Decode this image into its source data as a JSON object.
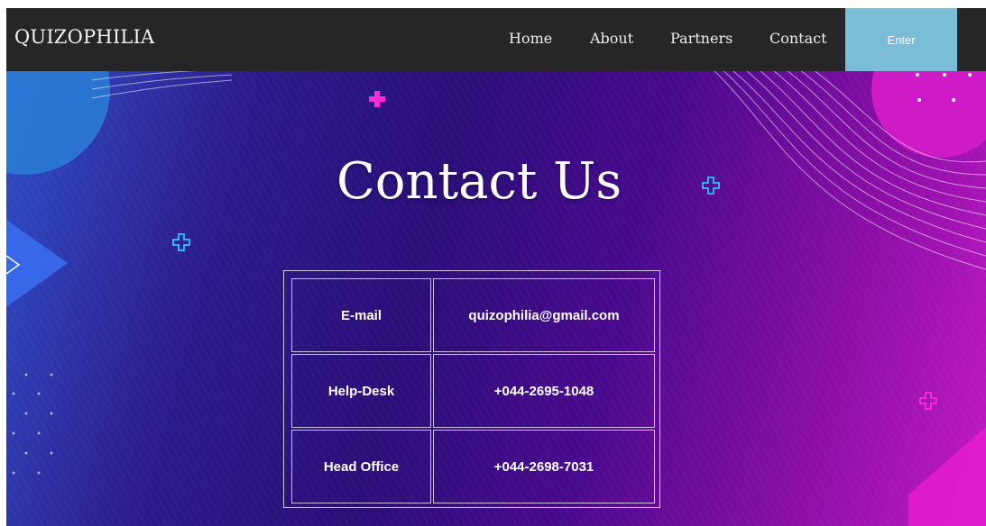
{
  "header": {
    "brand": "QUIZOPHILIA",
    "nav": [
      {
        "label": "Home"
      },
      {
        "label": "About"
      },
      {
        "label": "Partners"
      },
      {
        "label": "Contact"
      }
    ],
    "enter_label": "Enter"
  },
  "main": {
    "title": "Contact Us",
    "contacts": [
      {
        "label": "E-mail",
        "value": "quizophilia@gmail.com"
      },
      {
        "label": "Help-Desk",
        "value": "+044-2695-1048"
      },
      {
        "label": "Head Office",
        "value": "+044-2698-7031"
      }
    ]
  },
  "colors": {
    "navbar": "#262626",
    "enter_button": "#7bbcd6",
    "accent_pink": "#ff2bd6",
    "accent_cyan": "#2fc3ff"
  },
  "icons": [
    "plus-icon",
    "plus-outline-icon",
    "triangle-shape",
    "circle-shape",
    "wave-lines",
    "dot-grid"
  ]
}
